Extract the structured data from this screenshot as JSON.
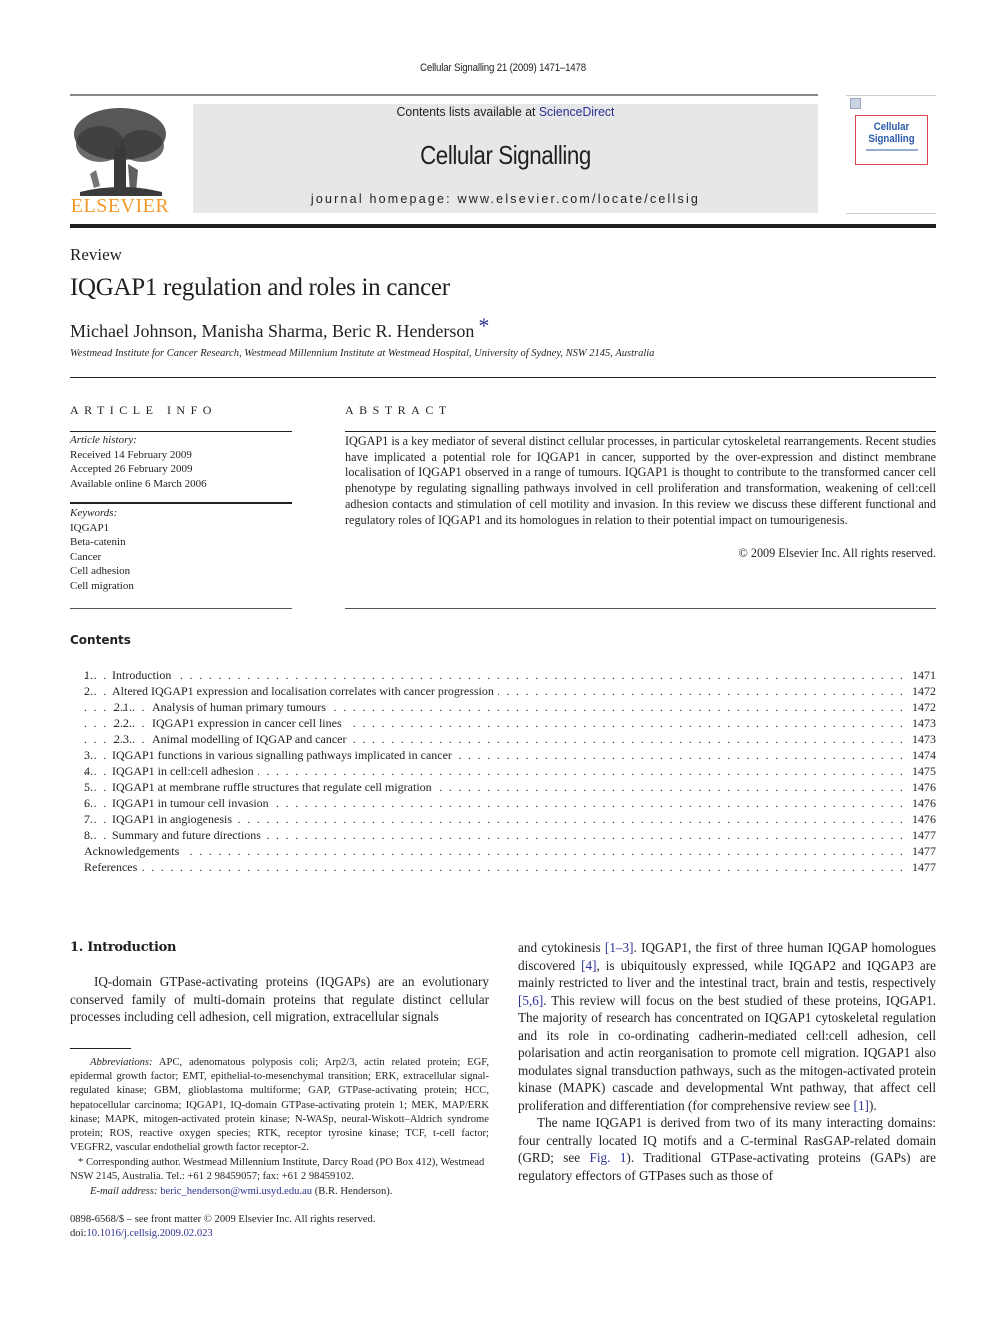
{
  "running_head": "Cellular Signalling 21 (2009) 1471–1478",
  "masthead": {
    "publisher_logo_text": "ELSEVIER",
    "contents_prefix": "Contents lists available at ",
    "contents_link": "ScienceDirect",
    "journal_name": "Cellular Signalling",
    "homepage": "journal homepage: www.elsevier.com/locate/cellsig",
    "cover_title_line1": "Cellular",
    "cover_title_line2": "Signalling",
    "colors": {
      "elsevier_orange": "#f39a2b",
      "link_blue": "#2e3192",
      "masthead_gray": "#e6e7e8",
      "cover_border": "#d9464f"
    }
  },
  "article": {
    "type": "Review",
    "title": "IQGAP1 regulation and roles in cancer",
    "authors": "Michael Johnson, Manisha Sharma, Beric R. Henderson",
    "author_mark": "*",
    "affiliation": "Westmead Institute for Cancer Research, Westmead Millennium Institute at Westmead Hospital, University of Sydney, NSW 2145, Australia"
  },
  "article_info": {
    "heading": "ARTICLE INFO",
    "history_label": "Article history:",
    "received": "Received 14 February 2009",
    "accepted": "Accepted 26 February 2009",
    "online": "Available online 6 March 2006",
    "keywords_label": "Keywords:",
    "keywords": [
      "IQGAP1",
      "Beta-catenin",
      "Cancer",
      "Cell adhesion",
      "Cell migration"
    ]
  },
  "abstract": {
    "heading": "ABSTRACT",
    "text": "IQGAP1 is a key mediator of several distinct cellular processes, in particular cytoskeletal rearrangements. Recent studies have implicated a potential role for IQGAP1 in cancer, supported by the over-expression and distinct membrane localisation of IQGAP1 observed in a range of tumours. IQGAP1 is thought to contribute to the transformed cancer cell phenotype by regulating signalling pathways involved in cell proliferation and transformation, weakening of cell:cell adhesion contacts and stimulation of cell motility and invasion. In this review we discuss these different functional and regulatory roles of IQGAP1 and its homologues in relation to their potential impact on tumourigenesis.",
    "copyright": "© 2009 Elsevier Inc. All rights reserved."
  },
  "contents": {
    "heading": "Contents",
    "entries": [
      {
        "num": "1.",
        "label": "Introduction",
        "page": "1471",
        "level": 1
      },
      {
        "num": "2.",
        "label": "Altered IQGAP1 expression and localisation correlates with cancer progression",
        "page": "1472",
        "level": 1
      },
      {
        "num": "2.1.",
        "label": "Analysis of human primary tumours",
        "page": "1472",
        "level": 2
      },
      {
        "num": "2.2.",
        "label": "IQGAP1 expression in cancer cell lines",
        "page": "1473",
        "level": 2
      },
      {
        "num": "2.3.",
        "label": "Animal modelling of IQGAP and cancer",
        "page": "1473",
        "level": 2
      },
      {
        "num": "3.",
        "label": "IQGAP1 functions in various signalling pathways implicated in cancer",
        "page": "1474",
        "level": 1
      },
      {
        "num": "4.",
        "label": "IQGAP1 in cell:cell adhesion",
        "page": "1475",
        "level": 1
      },
      {
        "num": "5.",
        "label": "IQGAP1 at membrane ruffle structures that regulate cell migration",
        "page": "1476",
        "level": 1
      },
      {
        "num": "6.",
        "label": "IQGAP1 in tumour cell invasion",
        "page": "1476",
        "level": 1
      },
      {
        "num": "7.",
        "label": "IQGAP1 in angiogenesis",
        "page": "1476",
        "level": 1
      },
      {
        "num": "8.",
        "label": "Summary and future directions",
        "page": "1477",
        "level": 1
      },
      {
        "num": "",
        "label": "Acknowledgements",
        "page": "1477",
        "level": 0
      },
      {
        "num": "",
        "label": "References",
        "page": "1477",
        "level": 0
      }
    ]
  },
  "body": {
    "intro_heading": "1. Introduction",
    "intro_p1": "IQ-domain GTPase-activating proteins (IQGAPs) are an evolutionary conserved family of multi-domain proteins that regulate distinct cellular processes including cell adhesion, cell migration, extracellular signals",
    "col2_p1": [
      {
        "t": "and cytokinesis "
      },
      {
        "t": "[1–3]",
        "link": true
      },
      {
        "t": ". IQGAP1, the first of three human IQGAP homologues discovered "
      },
      {
        "t": "[4]",
        "link": true
      },
      {
        "t": ", is ubiquitously expressed, while IQGAP2 and IQGAP3 are mainly restricted to liver and the intestinal tract, brain and testis, respectively "
      },
      {
        "t": "[5,6]",
        "link": true
      },
      {
        "t": ". This review will focus on the best studied of these proteins, IQGAP1. The majority of research has concentrated on IQGAP1 cytoskeletal regulation and its role in co-ordinating cadherin-mediated cell:cell adhesion, cell polarisation and actin reorganisation to promote cell migration. IQGAP1 also modulates signal transduction pathways, such as the mitogen-activated protein kinase (MAPK) cascade and developmental Wnt pathway, that affect cell proliferation and differentiation (for comprehensive review see "
      },
      {
        "t": "[1]",
        "link": true
      },
      {
        "t": ")."
      }
    ],
    "col2_p2": [
      {
        "t": "The name IQGAP1 is derived from two of its many interacting domains: four centrally located IQ motifs and a C-terminal RasGAP-related domain (GRD; see "
      },
      {
        "t": "Fig. 1",
        "link": true
      },
      {
        "t": "). Traditional GTPase-activating proteins (GAPs) are regulatory effectors of GTPases such as those of"
      }
    ]
  },
  "footnotes": {
    "abbrev_label": "Abbreviations:",
    "abbrev_text": " APC, adenomatous polyposis coli; Arp2/3, actin related protein; EGF, epidermal growth factor; EMT, epithelial-to-mesenchymal transition; ERK, extracellular signal-regulated kinase; GBM, glioblastoma multiforme; GAP, GTPase-activating protein; HCC, hepatocellular carcinoma; IQGAP1, IQ-domain GTPase-activating protein 1; MEK, MAP/ERK kinase; MAPK, mitogen-activated protein kinase; N-WASp, neural-Wiskott–Aldrich syndrome protein; ROS, reactive oxygen species; RTK, receptor tyrosine kinase; TCF, t-cell factor; VEGFR2, vascular endothelial growth factor receptor-2.",
    "corresp": "* Corresponding author. Westmead Millennium Institute, Darcy Road (PO Box 412), Westmead NSW 2145, Australia. Tel.: +61 2 98459057; fax: +61 2 98459102.",
    "email_label": "E-mail address:",
    "email": "beric_henderson@wmi.usyd.edu.au",
    "email_suffix": " (B.R. Henderson).",
    "front_matter": "0898-6568/$ – see front matter © 2009 Elsevier Inc. All rights reserved.",
    "doi_prefix": "doi:",
    "doi": "10.1016/j.cellsig.2009.02.023"
  }
}
